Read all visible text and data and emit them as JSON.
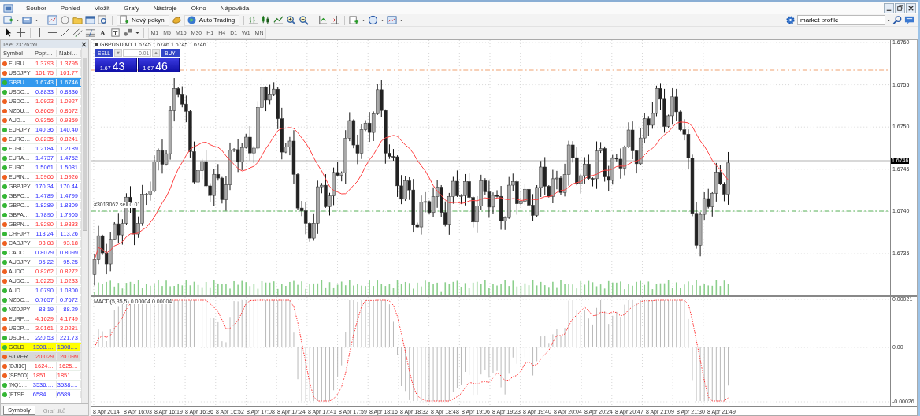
{
  "menu": [
    "Soubor",
    "Pohled",
    "Vložit",
    "Grafy",
    "Nástroje",
    "Okno",
    "Nápověda"
  ],
  "toolbar": {
    "new_order": "Nový pokyn",
    "auto_trading": "Auto Trading",
    "text_tool": "A",
    "search": {
      "value": "market profile"
    }
  },
  "timeframes": [
    "M1",
    "M5",
    "M15",
    "M30",
    "H1",
    "H4",
    "D1",
    "W1",
    "MN"
  ],
  "market_watch": {
    "title": "Tele: 23:26:59",
    "columns": [
      "Symbol",
      "Popt…",
      "Nabí…"
    ],
    "rows": [
      {
        "symbol": "EURU…",
        "bid": "1.3793",
        "ask": "1.3795",
        "rising": false,
        "selected": false
      },
      {
        "symbol": "USDJPY",
        "bid": "101.75",
        "ask": "101.77",
        "rising": false,
        "selected": false
      },
      {
        "symbol": "GBPU…",
        "bid": "1.6743",
        "ask": "1.6746",
        "rising": true,
        "selected": true
      },
      {
        "symbol": "USDC…",
        "bid": "0.8833",
        "ask": "0.8836",
        "rising": true,
        "selected": false
      },
      {
        "symbol": "USDC…",
        "bid": "1.0923",
        "ask": "1.0927",
        "rising": false,
        "selected": false
      },
      {
        "symbol": "NZDU…",
        "bid": "0.8669",
        "ask": "0.8672",
        "rising": false,
        "selected": false
      },
      {
        "symbol": "AUD…",
        "bid": "0.9356",
        "ask": "0.9359",
        "rising": false,
        "selected": false
      },
      {
        "symbol": "EURJPY",
        "bid": "140.36",
        "ask": "140.40",
        "rising": true,
        "selected": false
      },
      {
        "symbol": "EURG…",
        "bid": "0.8235",
        "ask": "0.8241",
        "rising": false,
        "selected": false
      },
      {
        "symbol": "EURC…",
        "bid": "1.2184",
        "ask": "1.2189",
        "rising": true,
        "selected": false
      },
      {
        "symbol": "EURA…",
        "bid": "1.4737",
        "ask": "1.4752",
        "rising": true,
        "selected": false
      },
      {
        "symbol": "EURC…",
        "bid": "1.5061",
        "ask": "1.5081",
        "rising": true,
        "selected": false
      },
      {
        "symbol": "EURN…",
        "bid": "1.5906",
        "ask": "1.5926",
        "rising": false,
        "selected": false
      },
      {
        "symbol": "GBPJPY",
        "bid": "170.34",
        "ask": "170.44",
        "rising": true,
        "selected": false
      },
      {
        "symbol": "GBPC…",
        "bid": "1.4789",
        "ask": "1.4799",
        "rising": true,
        "selected": false
      },
      {
        "symbol": "GBPC…",
        "bid": "1.8289",
        "ask": "1.8309",
        "rising": true,
        "selected": false
      },
      {
        "symbol": "GBPA…",
        "bid": "1.7890",
        "ask": "1.7905",
        "rising": true,
        "selected": false
      },
      {
        "symbol": "GBPN…",
        "bid": "1.9290",
        "ask": "1.9333",
        "rising": false,
        "selected": false
      },
      {
        "symbol": "CHFJPY",
        "bid": "113.24",
        "ask": "113.26",
        "rising": true,
        "selected": false
      },
      {
        "symbol": "CADJPY",
        "bid": "93.08",
        "ask": "93.18",
        "rising": false,
        "selected": false
      },
      {
        "symbol": "CADC…",
        "bid": "0.8079",
        "ask": "0.8099",
        "rising": true,
        "selected": false
      },
      {
        "symbol": "AUDJPY",
        "bid": "95.22",
        "ask": "95.25",
        "rising": true,
        "selected": false
      },
      {
        "symbol": "AUDC…",
        "bid": "0.8262",
        "ask": "0.8272",
        "rising": false,
        "selected": false
      },
      {
        "symbol": "AUDC…",
        "bid": "1.0225",
        "ask": "1.0233",
        "rising": false,
        "selected": false
      },
      {
        "symbol": "AUD…",
        "bid": "1.0790",
        "ask": "1.0800",
        "rising": true,
        "selected": false
      },
      {
        "symbol": "NZDC…",
        "bid": "0.7657",
        "ask": "0.7672",
        "rising": true,
        "selected": false
      },
      {
        "symbol": "NZDJPY",
        "bid": "88.19",
        "ask": "88.29",
        "rising": true,
        "selected": false
      },
      {
        "symbol": "EURP…",
        "bid": "4.1629",
        "ask": "4.1749",
        "rising": false,
        "selected": false
      },
      {
        "symbol": "USDP…",
        "bid": "3.0161",
        "ask": "3.0281",
        "rising": false,
        "selected": false
      },
      {
        "symbol": "USDH…",
        "bid": "220.53",
        "ask": "221.73",
        "rising": true,
        "selected": false
      },
      {
        "symbol": "GOLD",
        "bid": "1308.…",
        "ask": "1308.…",
        "rising": true,
        "selected": false,
        "color": "#ffff00"
      },
      {
        "symbol": "SILVER",
        "bid": "20.029",
        "ask": "20.099",
        "rising": false,
        "selected": false,
        "color": "#d8d8d8"
      },
      {
        "symbol": "[DJI30]",
        "bid": "1624…",
        "ask": "1625…",
        "rising": false,
        "selected": false
      },
      {
        "symbol": "[SP500]",
        "bid": "1851.…",
        "ask": "1851.…",
        "rising": false,
        "selected": false
      },
      {
        "symbol": "[NQ1…",
        "bid": "3536.…",
        "ask": "3538.…",
        "rising": true,
        "selected": false
      },
      {
        "symbol": "[FTSE…",
        "bid": "6584.…",
        "ask": "6589.…",
        "rising": true,
        "selected": false
      }
    ],
    "tabs": [
      {
        "label": "Symboly",
        "selected": true
      },
      {
        "label": "Graf tiků",
        "selected": false
      }
    ]
  },
  "chart": {
    "title": "GBPUSD,M1  1.6745 1.6746 1.6745 1.6746",
    "one_click": {
      "sell": "SELL",
      "buy": "BUY",
      "lot": "0.01",
      "sell_price": {
        "prefix": "1.67",
        "digits": "43"
      },
      "buy_price": {
        "prefix": "1.67",
        "digits": "46"
      }
    },
    "order_label": "#3013062 sell 0.01",
    "price_axis": [
      "1.6760",
      "1.6755",
      "1.6750",
      "1.6745",
      "1.6740",
      "1.6735"
    ],
    "current_price": "1.6746",
    "indicator_label": "MACD(5,35,5) 0.00004 0.00004",
    "indicator_axis": [
      "0.00021",
      "0.00",
      "-0.00026"
    ],
    "time_axis": [
      "8 Apr 2014",
      "8 Apr 16:03",
      "8 Apr 16:19",
      "8 Apr 16:36",
      "8 Apr 16:52",
      "8 Apr 17:08",
      "8 Apr 17:24",
      "8 Apr 17:41",
      "8 Apr 17:59",
      "8 Apr 18:16",
      "8 Apr 18:32",
      "8 Apr 18:48",
      "8 Apr 19:06",
      "8 Apr 19:23",
      "8 Apr 19:40",
      "8 Apr 20:04",
      "8 Apr 20:24",
      "8 Apr 20:47",
      "8 Apr 21:09",
      "8 Apr 21:30",
      "8 Apr 21:49"
    ]
  }
}
